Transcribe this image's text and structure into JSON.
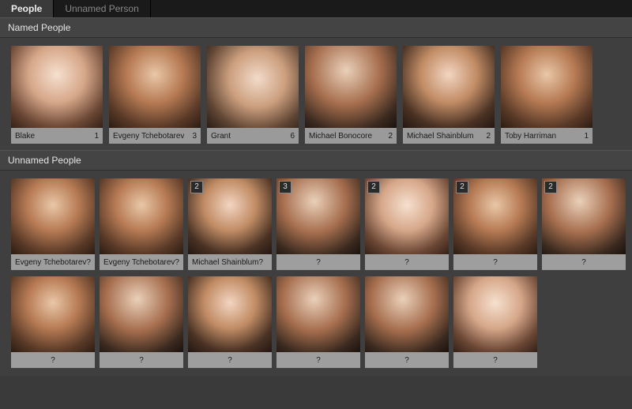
{
  "tabs": {
    "people": "People",
    "unnamed_person": "Unnamed Person",
    "active": "people"
  },
  "sections": {
    "named_title": "Named People",
    "unnamed_title": "Unnamed People"
  },
  "named": [
    {
      "name": "Blake",
      "count": "1"
    },
    {
      "name": "Evgeny Tchebotarev",
      "count": "3"
    },
    {
      "name": "Grant",
      "count": "6"
    },
    {
      "name": "Michael Bonocore",
      "count": "2"
    },
    {
      "name": "Michael Shainblum",
      "count": "2"
    },
    {
      "name": "Toby Harriman",
      "count": "1"
    }
  ],
  "unnamed_row1": [
    {
      "suggested": "Evgeny Tchebotarev?",
      "stack": null
    },
    {
      "suggested": "Evgeny Tchebotarev?",
      "stack": null
    },
    {
      "suggested": "Michael Shainblum?",
      "stack": "2"
    },
    {
      "suggested": "?",
      "stack": "3"
    },
    {
      "suggested": "?",
      "stack": "2"
    },
    {
      "suggested": "?",
      "stack": "2"
    },
    {
      "suggested": "?",
      "stack": "2"
    }
  ],
  "unnamed_row2": [
    {
      "suggested": "?",
      "stack": null
    },
    {
      "suggested": "?",
      "stack": null
    },
    {
      "suggested": "?",
      "stack": null
    },
    {
      "suggested": "?",
      "stack": null
    },
    {
      "suggested": "?",
      "stack": null
    },
    {
      "suggested": "?",
      "stack": null
    }
  ]
}
